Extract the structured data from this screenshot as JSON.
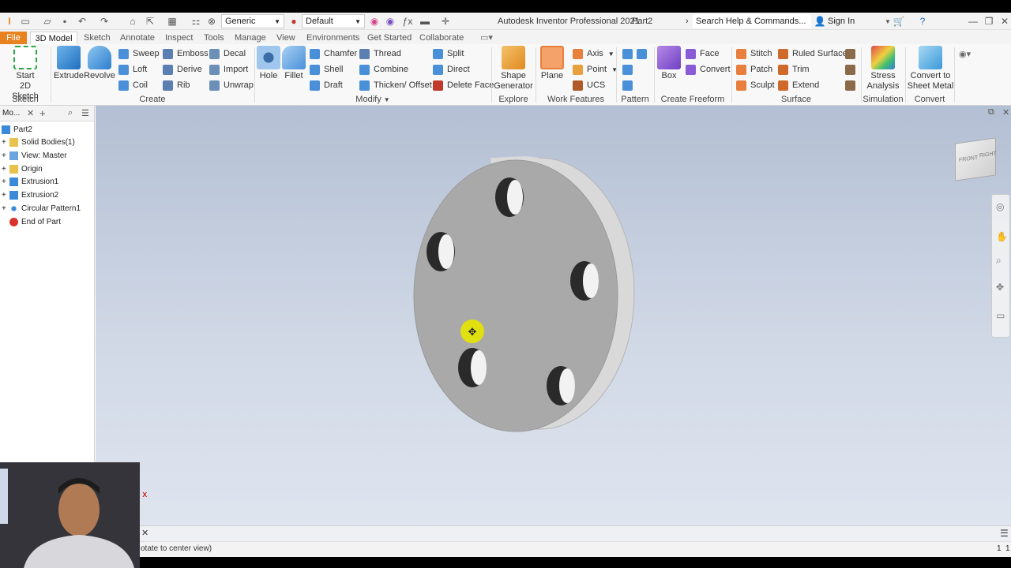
{
  "title": {
    "app_title": "Autodesk Inventor Professional 2021",
    "doc_name": "Part2",
    "search_placeholder": "Search Help & Commands...",
    "sign_in": "Sign In",
    "material": "Generic",
    "appearance": "Default"
  },
  "tabs": [
    "File",
    "3D Model",
    "Sketch",
    "Annotate",
    "Inspect",
    "Tools",
    "Manage",
    "View",
    "Environments",
    "Get Started",
    "Collaborate"
  ],
  "ribbon": {
    "sketch": {
      "btn": "Start",
      "btn2": "2D Sketch",
      "panel": "Sketch"
    },
    "create": {
      "extrude": "Extrude",
      "revolve": "Revolve",
      "sweep": "Sweep",
      "loft": "Loft",
      "coil": "Coil",
      "emboss": "Emboss",
      "derive": "Derive",
      "rib": "Rib",
      "decal": "Decal",
      "import": "Import",
      "unwrap": "Unwrap",
      "panel": "Create"
    },
    "modify": {
      "hole": "Hole",
      "fillet": "Fillet",
      "chamfer": "Chamfer",
      "shell": "Shell",
      "draft": "Draft",
      "thread": "Thread",
      "combine": "Combine",
      "thicken": "Thicken/ Offset",
      "split": "Split",
      "direct": "Direct",
      "delete_face": "Delete Face",
      "panel": "Modify"
    },
    "explore": {
      "btn": "Shape",
      "btn2": "Generator",
      "panel": "Explore"
    },
    "work": {
      "plane": "Plane",
      "axis": "Axis",
      "point": "Point",
      "ucs": "UCS",
      "panel": "Work Features"
    },
    "pattern": {
      "panel": "Pattern"
    },
    "freeform": {
      "box": "Box",
      "face": "Face",
      "convert": "Convert",
      "panel": "Create Freeform"
    },
    "surface": {
      "stitch": "Stitch",
      "patch": "Patch",
      "sculpt": "Sculpt",
      "ruled": "Ruled Surface",
      "trim": "Trim",
      "extend": "Extend",
      "panel": "Surface"
    },
    "simulation": {
      "btn": "Stress",
      "btn2": "Analysis",
      "panel": "Simulation"
    },
    "convert": {
      "btn": "Convert to",
      "btn2": "Sheet Metal",
      "panel": "Convert"
    }
  },
  "browser": {
    "header": "Mo...",
    "items": [
      {
        "label": "Part2"
      },
      {
        "label": "Solid Bodies(1)"
      },
      {
        "label": "View: Master"
      },
      {
        "label": "Origin"
      },
      {
        "label": "Extrusion1"
      },
      {
        "label": "Extrusion2"
      },
      {
        "label": "Circular Pattern1"
      },
      {
        "label": "End of Part"
      }
    ]
  },
  "viewcube": {
    "front": "FRONT",
    "right": "RIGHT"
  },
  "status": {
    "text": "otate to center view)",
    "right1": "1",
    "right2": "1"
  },
  "colors": {
    "accent": "#0696d7",
    "part_face": "#a9a9a9",
    "file_tab": "#e8821e"
  }
}
